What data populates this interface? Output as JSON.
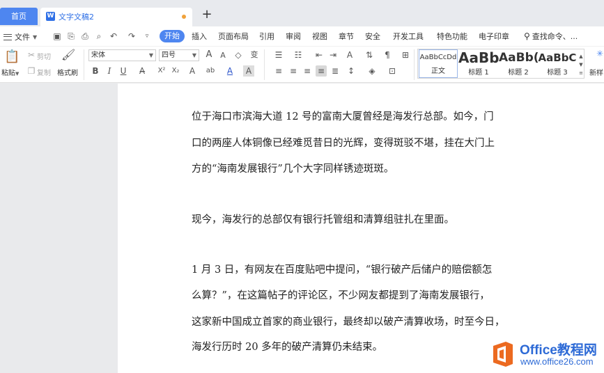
{
  "tabs": {
    "home_label": "首页",
    "doc_title": "文字文稿2",
    "doc_icon_letter": "W",
    "add_symbol": "+"
  },
  "menu": {
    "file_label": "文件",
    "items": [
      "开始",
      "插入",
      "页面布局",
      "引用",
      "审阅",
      "视图",
      "章节",
      "安全",
      "开发工具",
      "特色功能",
      "电子印章"
    ],
    "active_index": 0,
    "search_label": "查找命令、..."
  },
  "ribbon": {
    "paste_label": "粘贴",
    "cut_label": "剪切",
    "copy_label": "复制",
    "format_painter_label": "格式刷",
    "font_name": "宋体",
    "font_size": "四号",
    "bold": "B",
    "italic": "I",
    "underline": "U",
    "styles": [
      {
        "preview": "AaBbCcDd",
        "label": "正文"
      },
      {
        "preview": "AaBb",
        "label": "标题 1"
      },
      {
        "preview": "AaBb(",
        "label": "标题 2"
      },
      {
        "preview": "AaBbC",
        "label": "标题 3"
      }
    ],
    "new_style_label": "新样"
  },
  "document": {
    "lines": [
      "位于海口市滨海大道 12 号的富南大厦曾经是海发行总部。如今，门",
      "口的两座人体铜像已经难觅昔日的光辉，变得斑驳不堪，挂在大门上",
      "方的“海南发展银行”几个大字同样锈迹斑斑。",
      "现今，海发行的总部仅有银行托管组和清算组驻扎在里面。",
      "1 月 3 日，有网友在百度贴吧中提问，“银行破产后储户的赔偿额怎",
      "么算？”，在这篇帖子的评论区，不少网友都提到了海南发展银行，",
      "这家新中国成立首家的商业银行，最终却以破产清算收场，时至今日，",
      "海发行历时 20 多年的破产清算仍未结束。"
    ]
  },
  "watermark": {
    "title": "Office教程网",
    "url": "www.office26.com"
  },
  "colors": {
    "accent": "#4e86f0",
    "watermark": "#2d6ad6",
    "logo_orange": "#ec6a20"
  }
}
